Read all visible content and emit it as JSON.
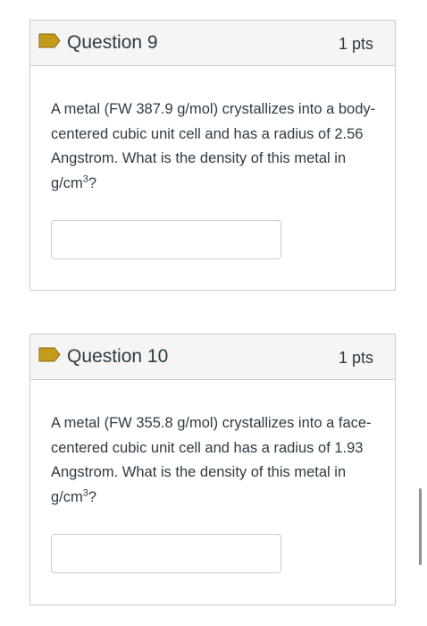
{
  "questions": [
    {
      "title": "Question 9",
      "points": "1 pts",
      "text_before": "A metal (FW 387.9 g/mol) crystallizes into a body-centered cubic unit cell and has a radius of 2.56 Angstrom.  What is the density of this metal in g/cm",
      "superscript": "3",
      "text_after": "?",
      "answer_value": ""
    },
    {
      "title": "Question 10",
      "points": "1 pts",
      "text_before": "A metal (FW 355.8 g/mol) crystallizes into a face-centered cubic unit cell and has a radius of 1.93 Angstrom.  What is the density of this metal in g/cm",
      "superscript": "3",
      "text_after": "?",
      "answer_value": ""
    }
  ],
  "icons": {
    "flag": "bookmark-flag-icon"
  },
  "colors": {
    "flag": "#c49a1a",
    "header_bg": "#f5f5f5",
    "border": "#c7cdd1",
    "text": "#2d3b45"
  }
}
